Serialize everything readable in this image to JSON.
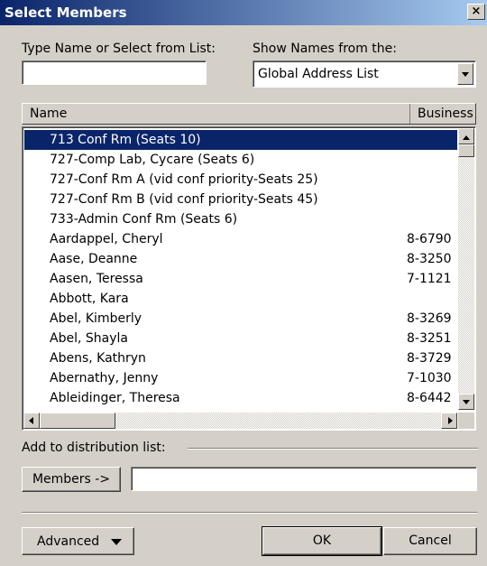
{
  "window": {
    "title": "Select Members",
    "close_glyph": "×"
  },
  "search": {
    "label": "Type Name or Select from List:",
    "value": ""
  },
  "source": {
    "label": "Show Names from the:",
    "selected": "Global Address List"
  },
  "list": {
    "columns": {
      "name": "Name",
      "phone": "Business P"
    },
    "rows": [
      {
        "name": "713 Conf Rm (Seats 10)",
        "phone": "",
        "selected": true
      },
      {
        "name": "727-Comp Lab, Cycare (Seats 6)",
        "phone": ""
      },
      {
        "name": "727-Conf Rm A (vid conf priority-Seats 25)",
        "phone": ""
      },
      {
        "name": "727-Conf Rm B (vid conf priority-Seats 45)",
        "phone": ""
      },
      {
        "name": "733-Admin Conf Rm (Seats 6)",
        "phone": ""
      },
      {
        "name": "Aardappel, Cheryl",
        "phone": "8-6790"
      },
      {
        "name": "Aase, Deanne",
        "phone": "8-3250"
      },
      {
        "name": "Aasen, Teressa",
        "phone": "7-1121"
      },
      {
        "name": "Abbott, Kara",
        "phone": ""
      },
      {
        "name": "Abel, Kimberly",
        "phone": "8-3269"
      },
      {
        "name": "Abel, Shayla",
        "phone": "8-3251"
      },
      {
        "name": "Abens, Kathryn",
        "phone": "8-3729"
      },
      {
        "name": "Abernathy, Jenny",
        "phone": "7-1030"
      },
      {
        "name": "Ableidinger, Theresa",
        "phone": "8-6442"
      }
    ]
  },
  "distribution": {
    "label": "Add to distribution list:",
    "members_button": "Members ->",
    "members_value": ""
  },
  "footer": {
    "advanced": "Advanced",
    "ok": "OK",
    "cancel": "Cancel"
  },
  "colors": {
    "selection": "#0a246a",
    "face": "#d4d0c8",
    "titlebar_start": "#0a246a",
    "titlebar_end": "#a6caf0"
  }
}
